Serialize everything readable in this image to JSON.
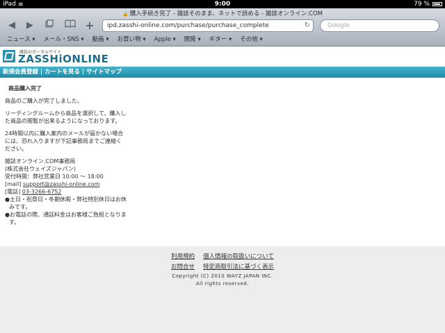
{
  "status_bar": {
    "device": "iPad",
    "time": "9:00",
    "battery": "79 %"
  },
  "browser": {
    "page_title": "購入手続き完了 - 雑誌そのまま、ネットで読める - 雑誌オンライン.COM",
    "url": "ipd.zasshi-online.com/purchase/purchase_complete",
    "search_placeholder": "Google",
    "bookmarks": [
      "ニュース ▾",
      "メール・SNS ▾",
      "動画 ▾",
      "お買い物 ▾",
      "Apple ▾",
      "開発 ▾",
      "ギター ▾",
      "その他 ▾"
    ]
  },
  "site": {
    "logo_sub": "雑誌のポータルサイト",
    "logo_main": "ZASSHiONLINE",
    "nav": {
      "register": "新規会員登録",
      "sep1": " | ",
      "cart": "カートを見る",
      "sep2": " | ",
      "sitemap": "サイトマップ"
    }
  },
  "content": {
    "title": "商品購入完了",
    "p1": "商品のご購入が完了しました。",
    "p2": " リーディングルームから商品を選択して、購入した商品の閲覧が出来るようになっております。",
    "p3": " 24時間以内に購入案内のメールが届かない場合には、恐れ入りますが下記事務局までご連絡ください。",
    "office": "雑誌オンライン.COM事務局",
    "company": "(株式会社ウェイズジャパン)",
    "hours": "受付時間：弊社営業日 10:00 〜 18:00",
    "mail_label": "[mail] ",
    "mail": "support@zasshi-online.com",
    "tel_label": "[電話] ",
    "tel": "03-3266-6752",
    "note1": "●土日・祝祭日・冬期休暇・弊社特別休日はお休みです。",
    "note2": "●お電話の際、通話料金はお客様ご負担となります。"
  },
  "footer": {
    "terms": "利用規約",
    "privacy": "個人情報の取扱いについて",
    "contact": "お問合せ",
    "law": "特定商取引法に基づく表示",
    "copyright": "Copyright (C) 2010 WAYZ JAPAN INC.",
    "rights": "All rights reserved."
  }
}
